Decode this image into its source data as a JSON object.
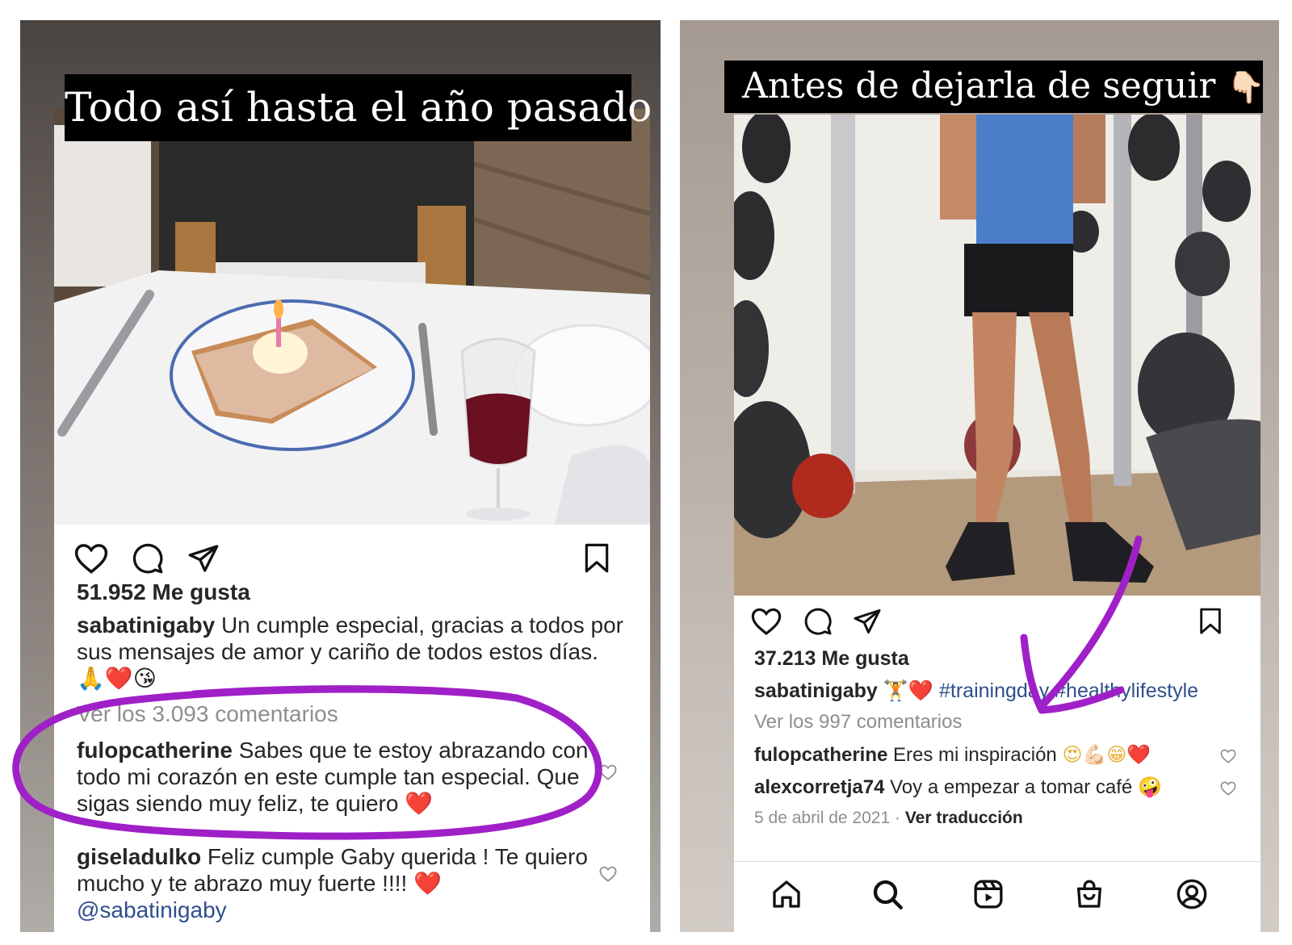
{
  "left_story": {
    "caption": "Todo así hasta el año pasado",
    "post": {
      "likes": "51.952 Me gusta",
      "caption_user": "sabatinigaby",
      "caption_text": "Un cumple especial, gracias a todos por sus mensajes de amor y cariño de todos estos días.",
      "caption_emojis": "🙏❤️😘",
      "view_comments": "Ver los 3.093 comentarios",
      "comments": [
        {
          "user": "fulopcatherine",
          "text": "Sabes que te estoy abrazando con todo mi corazón en este cumple tan especial. Que sigas siendo muy feliz, te quiero",
          "emoji": "❤️"
        },
        {
          "user": "giseladulko",
          "text": "Feliz cumple Gaby querida ! Te quiero mucho y te abrazo muy fuerte !!!!",
          "emoji": "❤️",
          "mention": "@sabatinigaby"
        }
      ]
    }
  },
  "right_story": {
    "caption": "Antes de dejarla de seguir",
    "caption_emoji": "👇🏻",
    "post": {
      "likes": "37.213 Me gusta",
      "caption_user": "sabatinigaby",
      "caption_emojis": "🏋️❤️",
      "caption_hashtags": "#trainingday #healthylifestyle",
      "view_comments": "Ver los 997 comentarios",
      "comments": [
        {
          "user": "fulopcatherine",
          "text": "Eres mi inspiración",
          "emoji": "😍💪🏻😁❤️"
        },
        {
          "user": "alexcorretja74",
          "text": "Voy a empezar a tomar café",
          "emoji": "🤪"
        }
      ],
      "date": "5 de abril de 2021",
      "separator": "·",
      "translate": "Ver traducción"
    }
  },
  "icons": {
    "like": "heart-icon",
    "comment": "comment-icon",
    "share": "paper-plane-icon",
    "save": "bookmark-icon",
    "home": "home-icon",
    "search": "search-icon",
    "reels": "reels-icon",
    "shop": "shop-bag-icon",
    "profile": "profile-icon"
  },
  "colors": {
    "annotation": "#a020c8",
    "text": "#262626",
    "muted": "#8e8e8e",
    "heart_red": "#e0242e",
    "hashtag": "#2f4f8c"
  }
}
